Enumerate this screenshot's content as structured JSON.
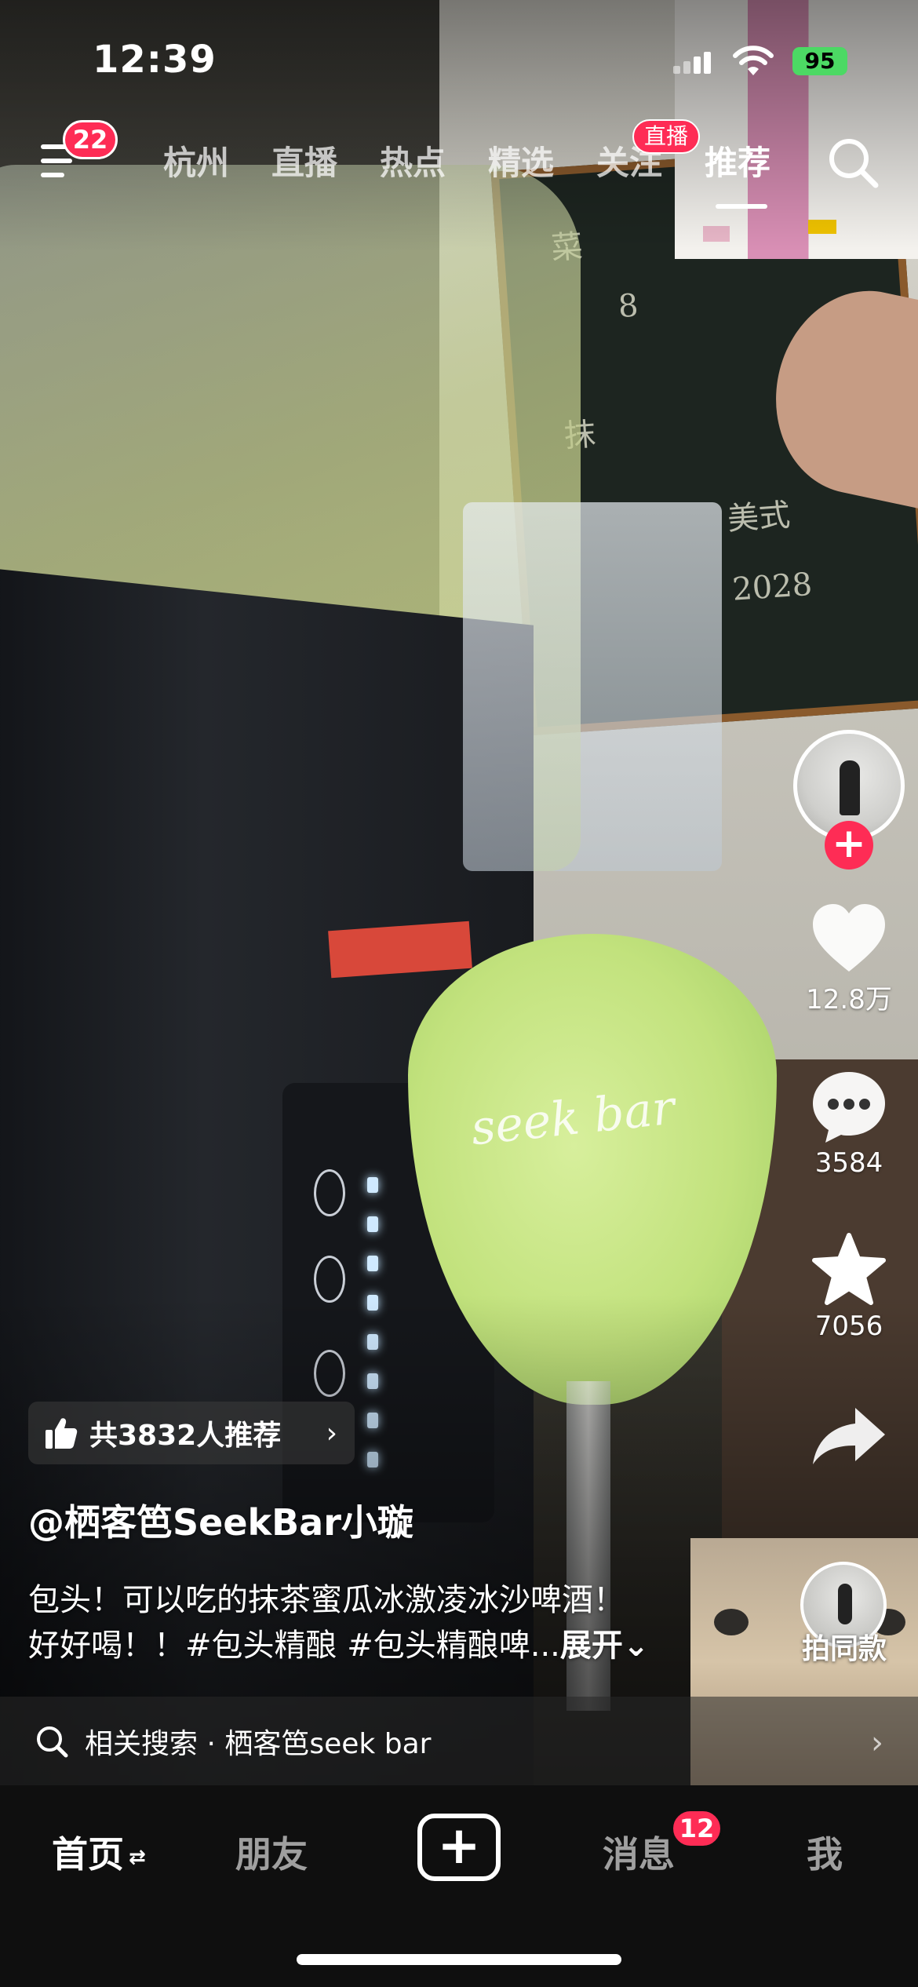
{
  "status_bar": {
    "time": "12:39",
    "battery": "95",
    "icons": [
      "signal-icon",
      "wifi-icon",
      "battery-icon"
    ]
  },
  "top_nav": {
    "menu_badge": "22",
    "tabs": [
      {
        "label": "杭州"
      },
      {
        "label": "直播"
      },
      {
        "label": "热点"
      },
      {
        "label": "精选"
      },
      {
        "label": "关注"
      },
      {
        "label": "推荐"
      }
    ],
    "active_tab": "推荐",
    "live_badge": "直播"
  },
  "video": {
    "glass_text": "seek bar"
  },
  "actions": {
    "likes": "12.8万",
    "comments": "3584",
    "favorites": "7056"
  },
  "caption": {
    "recommend": "共3832人推荐",
    "author": "@栖客笆SeekBar小璇",
    "desc_line1": "包头！可以吃的抹茶蜜瓜冰激凌冰沙啤酒！",
    "desc_line2": "好好喝！！#包头精酿 #包头精酿啤...",
    "expand": "展开",
    "same_label": "拍同款"
  },
  "related_search": {
    "prefix": "相关搜索",
    "dot": "·",
    "query": "栖客笆seek bar"
  },
  "tab_bar": {
    "home": "首页",
    "friends": "朋友",
    "messages": "消息",
    "messages_badge": "12",
    "me": "我"
  },
  "colors": {
    "accent": "#fe2c55",
    "tab_bar_bg": "#0f0f0f",
    "battery": "#4cd964"
  }
}
